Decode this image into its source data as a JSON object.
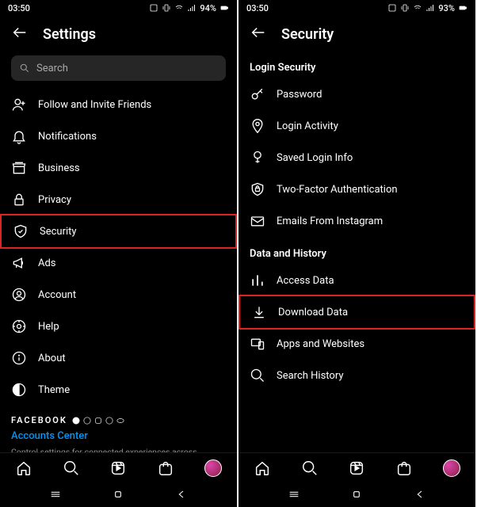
{
  "left": {
    "status_time": "03:50",
    "status_battery": "94%",
    "title": "Settings",
    "search_placeholder": "Search",
    "items": [
      {
        "label": "Follow and Invite Friends"
      },
      {
        "label": "Notifications"
      },
      {
        "label": "Business"
      },
      {
        "label": "Privacy"
      },
      {
        "label": "Security",
        "highlight": true
      },
      {
        "label": "Ads"
      },
      {
        "label": "Account"
      },
      {
        "label": "Help"
      },
      {
        "label": "About"
      },
      {
        "label": "Theme"
      }
    ],
    "facebook_label": "FACEBOOK",
    "accounts_center": "Accounts Center",
    "accounts_desc": "Control settings for connected experiences across Instagram, the Facebook app and Messenger, including story and post sharing and logging in."
  },
  "right": {
    "status_time": "03:50",
    "status_battery": "93%",
    "title": "Security",
    "section1": "Login Security",
    "items1": [
      {
        "label": "Password"
      },
      {
        "label": "Login Activity"
      },
      {
        "label": "Saved Login Info"
      },
      {
        "label": "Two-Factor Authentication"
      },
      {
        "label": "Emails From Instagram"
      }
    ],
    "section2": "Data and History",
    "items2": [
      {
        "label": "Access Data"
      },
      {
        "label": "Download Data",
        "highlight": true
      },
      {
        "label": "Apps and Websites"
      },
      {
        "label": "Search History"
      }
    ]
  }
}
